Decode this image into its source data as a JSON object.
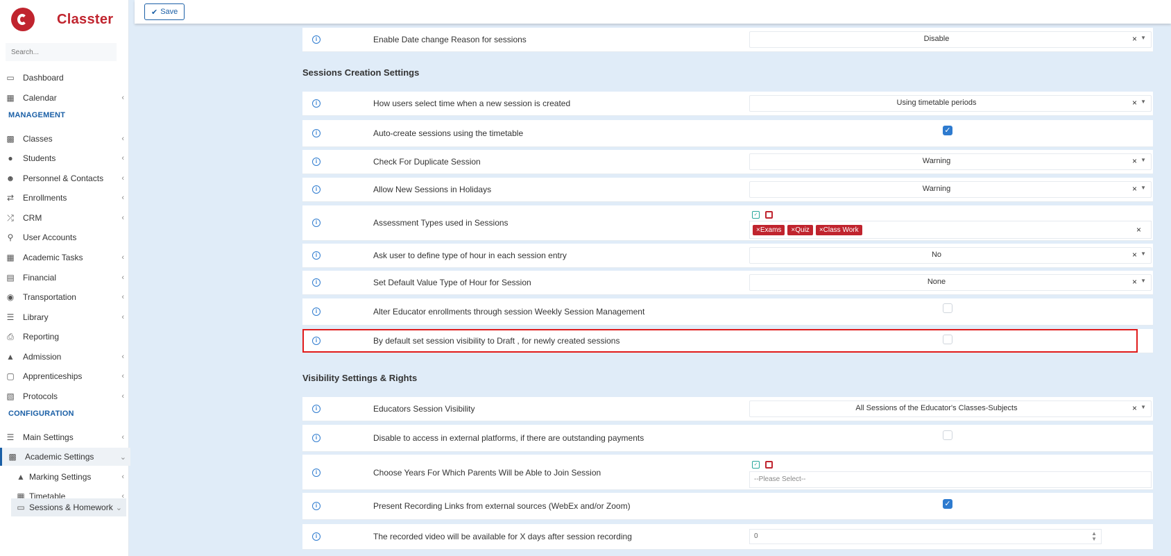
{
  "app": {
    "brand": "Classter",
    "search_placeholder": "Search..."
  },
  "toolbar": {
    "save_label": "Save"
  },
  "sidebar": {
    "items": [
      {
        "label": "Dashboard",
        "icon": "monitor-icon"
      },
      {
        "label": "Calendar",
        "icon": "calendar-icon"
      },
      {
        "label": "Classes",
        "icon": "classes-icon"
      },
      {
        "label": "Students",
        "icon": "students-icon"
      },
      {
        "label": "Personnel & Contacts",
        "icon": "personnel-icon"
      },
      {
        "label": "Enrollments",
        "icon": "exchange-icon"
      },
      {
        "label": "CRM",
        "icon": "shuffle-icon"
      },
      {
        "label": "User Accounts",
        "icon": "key-icon"
      },
      {
        "label": "Academic Tasks",
        "icon": "grid-icon"
      },
      {
        "label": "Financial",
        "icon": "money-icon"
      },
      {
        "label": "Transportation",
        "icon": "bus-icon"
      },
      {
        "label": "Library",
        "icon": "books-icon"
      },
      {
        "label": "Reporting",
        "icon": "print-icon"
      },
      {
        "label": "Admission",
        "icon": "bank-icon"
      },
      {
        "label": "Apprenticeships",
        "icon": "cube-icon"
      },
      {
        "label": "Protocols",
        "icon": "protocol-icon"
      },
      {
        "label": "Main Settings",
        "icon": "sliders-icon"
      },
      {
        "label": "Academic Settings",
        "icon": "classes-icon"
      },
      {
        "label": "Marking Settings",
        "icon": "graduation-icon"
      },
      {
        "label": "Timetable",
        "icon": "calendar-icon"
      },
      {
        "label": "Sessions & Homework",
        "icon": "sessions-icon"
      }
    ],
    "headers": {
      "management": "MANAGEMENT",
      "configuration": "CONFIGURATION"
    }
  },
  "main": {
    "top_row": {
      "label": "Enable Date change Reason for sessions",
      "value": "Disable"
    },
    "sections": {
      "creation": "Sessions Creation Settings",
      "visibility": "Visibility Settings & Rights"
    },
    "creation_rows": [
      {
        "label": "How users select time when a new session is created",
        "value": "Using timetable periods"
      },
      {
        "label": "Auto-create sessions using the timetable",
        "checked": true
      },
      {
        "label": "Check For Duplicate Session",
        "value": "Warning"
      },
      {
        "label": "Allow New Sessions in Holidays",
        "value": "Warning"
      },
      {
        "label": "Assessment Types used in Sessions",
        "tags": [
          "Exams",
          "Quiz",
          "Class Work"
        ]
      },
      {
        "label": "Ask user to define type of hour in each session entry",
        "value": "No"
      },
      {
        "label": "Set Default Value Type of Hour for Session",
        "value": "None"
      },
      {
        "label": "Alter Educator enrollments through session Weekly Session Management",
        "checked": false
      },
      {
        "label": "By default set session visibility to Draft , for newly created sessions",
        "checked": false
      }
    ],
    "visibility_rows": [
      {
        "label": "Educators Session Visibility",
        "value": "All Sessions of the Educator's Classes-Subjects"
      },
      {
        "label": "Disable to access in external platforms, if there are outstanding payments",
        "checked": false
      },
      {
        "label": "Choose Years For Which Parents Will be Able to Join Session",
        "placeholder": "--Please Select--"
      },
      {
        "label": "Present Recording Links from external sources (WebEx and/or Zoom)",
        "checked": true
      },
      {
        "label": "The recorded video will be available for X days after session recording",
        "number": "0"
      }
    ]
  },
  "colors": {
    "accent": "#1a5fa6",
    "brand": "#c0242e",
    "highlight": "#e01b1b",
    "background": "#e0ecf8"
  }
}
